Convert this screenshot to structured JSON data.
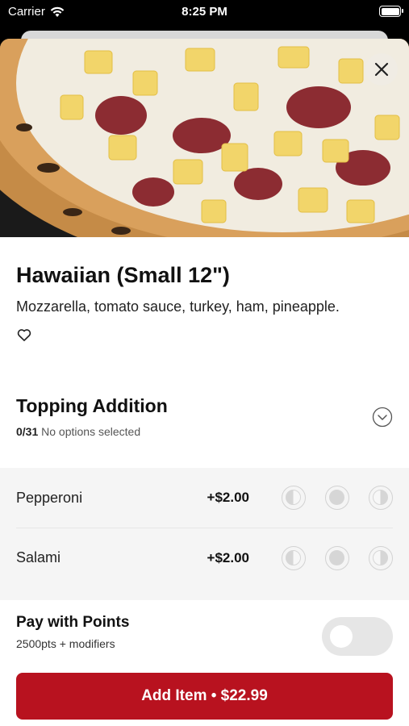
{
  "status_bar": {
    "carrier": "Carrier",
    "time": "8:25 PM"
  },
  "item": {
    "name": "Hawaiian (Small 12\")",
    "description": "Mozzarella, tomato sauce, turkey, ham, pineapple."
  },
  "topping_section": {
    "title": "Topping Addition",
    "count": "0/31",
    "status": "No options selected",
    "options": [
      {
        "name": "Pepperoni",
        "price": "+$2.00"
      },
      {
        "name": "Salami",
        "price": "+$2.00"
      }
    ]
  },
  "points": {
    "title": "Pay with Points",
    "subtitle": "2500pts + modifiers",
    "enabled": false
  },
  "add_button": {
    "label": "Add Item • $22.99"
  },
  "colors": {
    "accent": "#b8121f",
    "toggle_off": "#e6e6e6",
    "options_bg": "#f5f5f5"
  },
  "icons": [
    "wifi-icon",
    "battery-icon",
    "close-icon",
    "heart-icon",
    "chevron-down-icon",
    "left-half-icon",
    "whole-icon",
    "right-half-icon"
  ]
}
